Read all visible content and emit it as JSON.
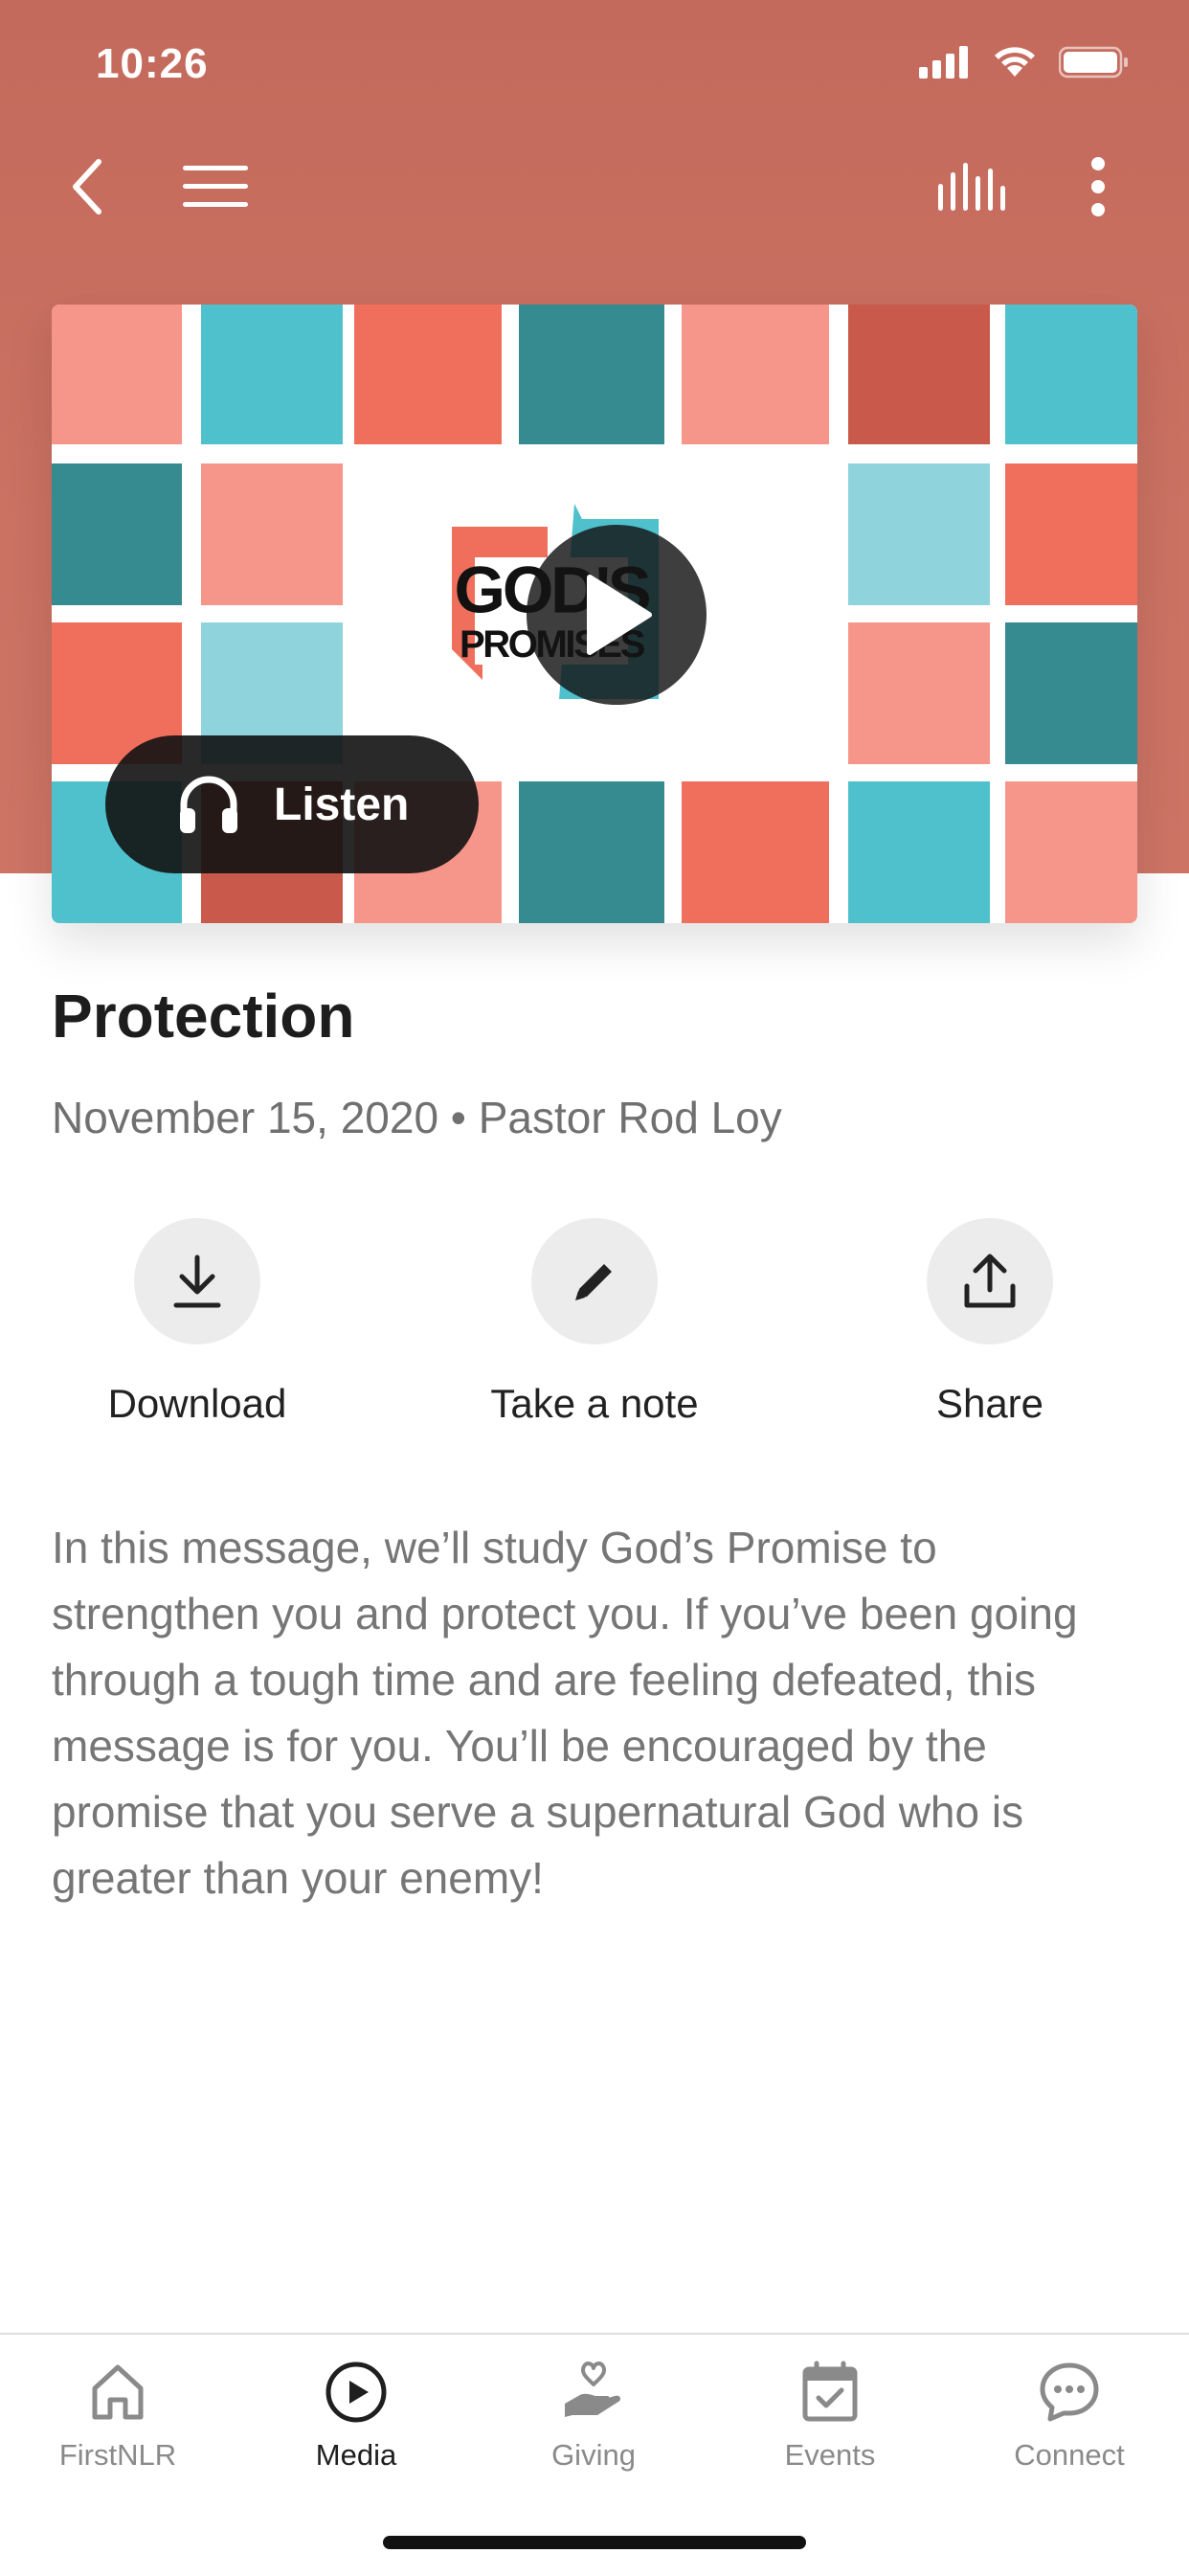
{
  "status_bar": {
    "time": "10:26"
  },
  "nav": {
    "back_icon": "chevron-left-icon",
    "menu_icon": "hamburger-menu-icon",
    "audio_icon": "audio-bars-icon",
    "more_icon": "more-vertical-icon"
  },
  "hero": {
    "artwork_line1": "GOD'S",
    "artwork_line2": "PROMISES",
    "listen_label": "Listen",
    "colors": {
      "salmon": "#f6958a",
      "teal": "#4fc1cc",
      "coral": "#f06f5c",
      "dark_teal": "#368b91",
      "light_teal": "#8fd3dc",
      "brick": "#c95a4b"
    }
  },
  "message": {
    "title": "Protection",
    "meta": "November 15, 2020 • Pastor Rod Loy",
    "description": "In this message, we’ll study God’s Promise to strengthen you and protect you.  If you’ve been going through a tough time and are feeling defeated, this message is for you.  You’ll be encouraged by the promise that you serve a supernatural God who is greater than your enemy!"
  },
  "actions": [
    {
      "label": "Download",
      "icon": "download-icon"
    },
    {
      "label": "Take a note",
      "icon": "pencil-icon"
    },
    {
      "label": "Share",
      "icon": "share-icon"
    }
  ],
  "tabs": [
    {
      "label": "FirstNLR",
      "icon": "home-icon"
    },
    {
      "label": "Media",
      "icon": "play-circle-icon",
      "active": true
    },
    {
      "label": "Giving",
      "icon": "giving-hand-icon"
    },
    {
      "label": "Events",
      "icon": "calendar-icon"
    },
    {
      "label": "Connect",
      "icon": "chat-bubble-icon"
    }
  ],
  "theme": {
    "header_color": "#c96f61",
    "active_tab": "#1f1f1f",
    "inactive_tab": "#8a8a8a"
  }
}
